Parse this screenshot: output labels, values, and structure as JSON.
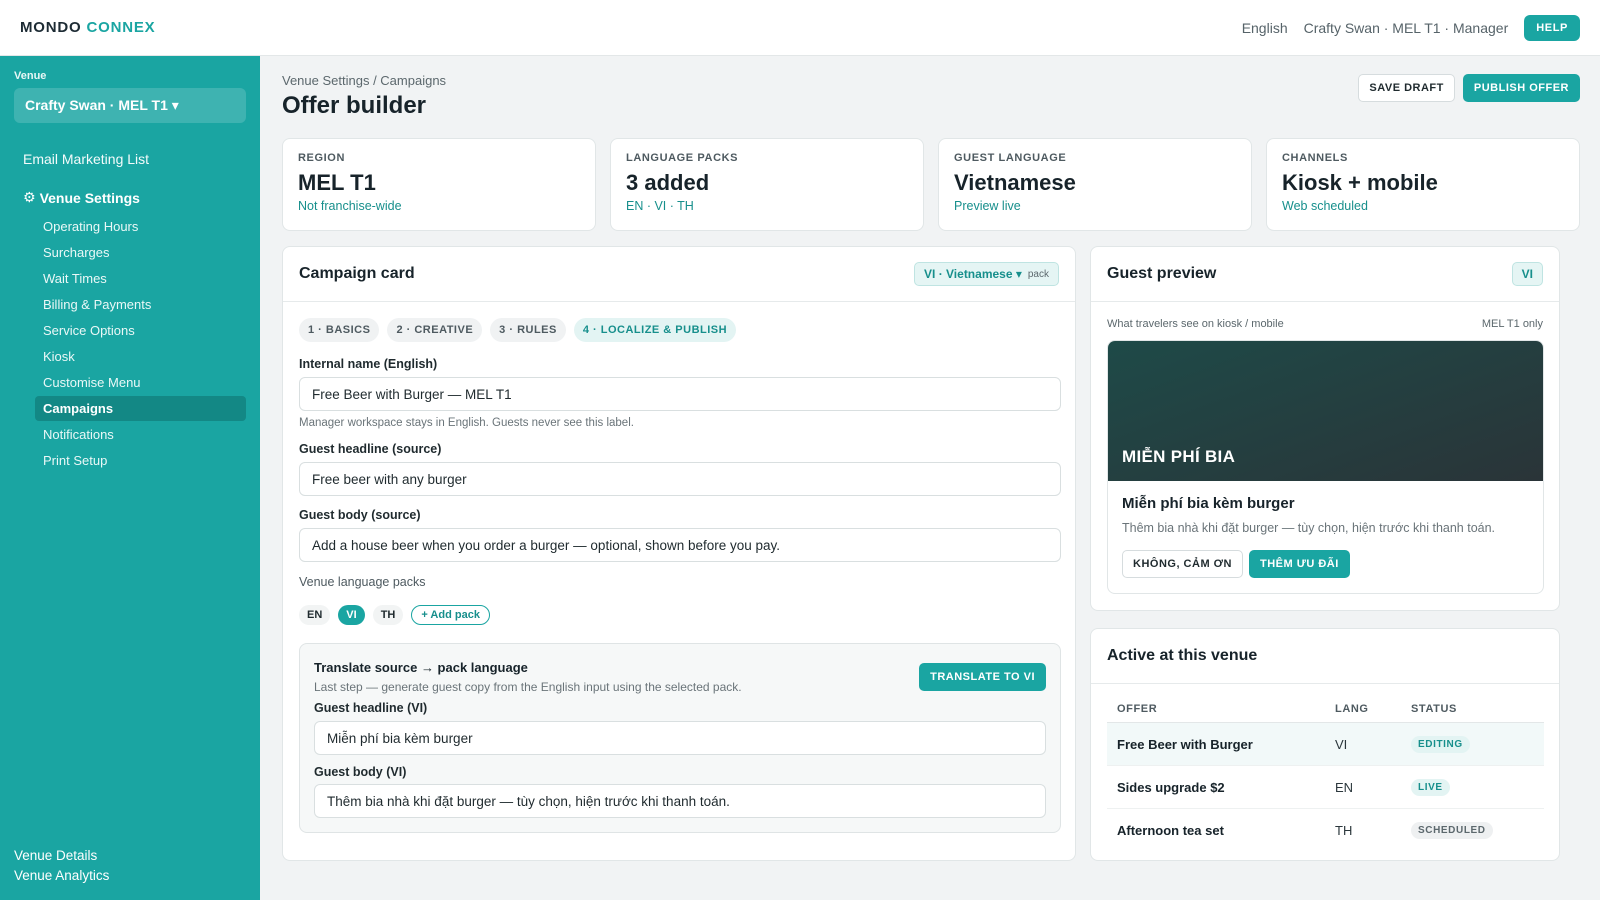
{
  "header": {
    "brand_part1": "MONDO",
    "brand_part2": "CONNEX",
    "language": "English",
    "user": "Crafty Swan · MEL T1 · Manager",
    "help": "HELP"
  },
  "sidebar": {
    "venue_label": "Venue",
    "venue_select": "Crafty Swan · MEL T1 ▾",
    "top_item": "Email Marketing List",
    "section": "Venue Settings",
    "section_icon": "⚙",
    "items": [
      {
        "label": "Operating Hours"
      },
      {
        "label": "Surcharges"
      },
      {
        "label": "Wait Times"
      },
      {
        "label": "Billing & Payments"
      },
      {
        "label": "Service Options"
      },
      {
        "label": "Kiosk"
      },
      {
        "label": "Customise Menu"
      },
      {
        "label": "Campaigns"
      },
      {
        "label": "Notifications"
      },
      {
        "label": "Print Setup"
      }
    ],
    "bottom": [
      "Venue Details",
      "Venue Analytics"
    ]
  },
  "page": {
    "breadcrumb": "Venue Settings / Campaigns",
    "title": "Offer builder",
    "save_draft": "SAVE DRAFT",
    "publish": "PUBLISH OFFER"
  },
  "stats": [
    {
      "label": "REGION",
      "value": "MEL T1",
      "sub": "Not franchise-wide"
    },
    {
      "label": "LANGUAGE PACKS",
      "value": "3 added",
      "sub": "EN · VI · TH"
    },
    {
      "label": "GUEST LANGUAGE",
      "value": "Vietnamese",
      "sub": "Preview live"
    },
    {
      "label": "CHANNELS",
      "value": "Kiosk + mobile",
      "sub": "Web scheduled"
    }
  ],
  "campaign": {
    "title": "Campaign card",
    "lang_pill": "VI · Vietnamese ▾",
    "lang_pill_small": "pack",
    "steps": [
      "1 · BASICS",
      "2 · CREATIVE",
      "3 · RULES",
      "4 · LOCALIZE & PUBLISH"
    ],
    "internal_name_label": "Internal name (English)",
    "internal_name_value": "Free Beer with Burger — MEL T1",
    "internal_name_hint": "Manager workspace stays in English. Guests never see this label.",
    "headline_label": "Guest headline (source)",
    "headline_value": "Free beer with any burger",
    "body_label": "Guest body (source)",
    "body_value": "Add a house beer when you order a burger — optional, shown before you pay.",
    "packs_label": "Venue language packs",
    "packs": [
      "EN",
      "VI",
      "TH"
    ],
    "add_pack": "+ Add pack",
    "translate": {
      "title": "Translate source → pack language",
      "sub": "Last step — generate guest copy from the English input using the selected pack.",
      "button": "TRANSLATE TO VI",
      "headline_label": "Guest headline (VI)",
      "headline_value": "Miễn phí bia kèm burger",
      "body_label": "Guest body (VI)",
      "body_value": "Thêm bia nhà khi đặt burger — tùy chọn, hiện trước khi thanh toán."
    }
  },
  "preview": {
    "title": "Guest preview",
    "lang": "VI",
    "meta_left": "What travelers see on kiosk / mobile",
    "meta_right": "MEL T1 only",
    "hero_text": "MIỄN PHÍ BIA",
    "card_title": "Miễn phí bia kèm burger",
    "card_body": "Thêm bia nhà khi đặt burger — tùy chọn, hiện trước khi thanh toán.",
    "decline": "KHÔNG, CẢM ƠN",
    "accept": "THÊM ƯU ĐÃI"
  },
  "active": {
    "title": "Active at this venue",
    "columns": [
      "OFFER",
      "LANG",
      "STATUS"
    ],
    "rows": [
      {
        "offer": "Free Beer with Burger",
        "lang": "VI",
        "status": "EDITING"
      },
      {
        "offer": "Sides upgrade $2",
        "lang": "EN",
        "status": "LIVE"
      },
      {
        "offer": "Afternoon tea set",
        "lang": "TH",
        "status": "SCHEDULED"
      }
    ]
  },
  "colors": {
    "accent": "#1aa5a2",
    "sidebar_bg": "#1aa5a2",
    "page_bg": "#f1f3f4"
  }
}
